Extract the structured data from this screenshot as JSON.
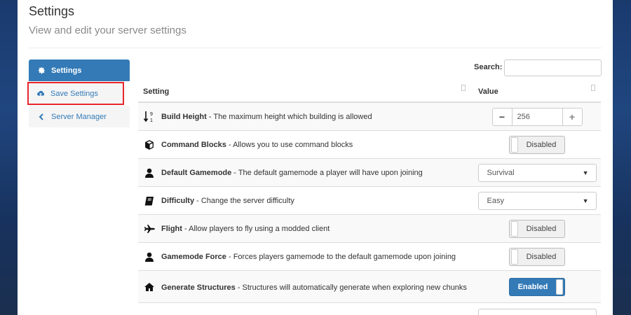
{
  "page": {
    "title": "Settings",
    "subtitle": "View and edit your server settings"
  },
  "sidebar": {
    "items": [
      {
        "label": "Settings",
        "icon": "gear-icon"
      },
      {
        "label": "Save Settings",
        "icon": "cloud-upload-icon"
      },
      {
        "label": "Server Manager",
        "icon": "chevron-left-icon"
      }
    ]
  },
  "search": {
    "label": "Search:",
    "value": "",
    "placeholder": ""
  },
  "table": {
    "headers": {
      "setting": "Setting",
      "value": "Value"
    },
    "rows": [
      {
        "name": "Build Height",
        "description": " - The maximum height which building is allowed",
        "icon": "sort-numeric-icon",
        "control": "stepper",
        "value": "256",
        "minus": "−",
        "plus": "+"
      },
      {
        "name": "Command Blocks",
        "description": " - Allows you to use command blocks",
        "icon": "cube-icon",
        "control": "toggle",
        "value": "Disabled"
      },
      {
        "name": "Default Gamemode",
        "description": " - The default gamemode a player will have upon joining",
        "icon": "user-icon",
        "control": "select",
        "value": "Survival"
      },
      {
        "name": "Difficulty",
        "description": " - Change the server difficulty",
        "icon": "book-icon",
        "control": "select",
        "value": "Easy"
      },
      {
        "name": "Flight",
        "description": " - Allow players to fly using a modded client",
        "icon": "plane-icon",
        "control": "toggle",
        "value": "Disabled"
      },
      {
        "name": "Gamemode Force",
        "description": " - Forces players gamemode to the default gamemode upon joining",
        "icon": "user-icon",
        "control": "toggle",
        "value": "Disabled"
      },
      {
        "name": "Generate Structures",
        "description": " - Structures will automatically generate when exploring new chunks",
        "icon": "home-icon",
        "control": "toggle",
        "value": "Enabled"
      }
    ]
  },
  "colors": {
    "primary": "#337ab7",
    "highlight_border": "#e8262b",
    "background": "#1c3660"
  }
}
